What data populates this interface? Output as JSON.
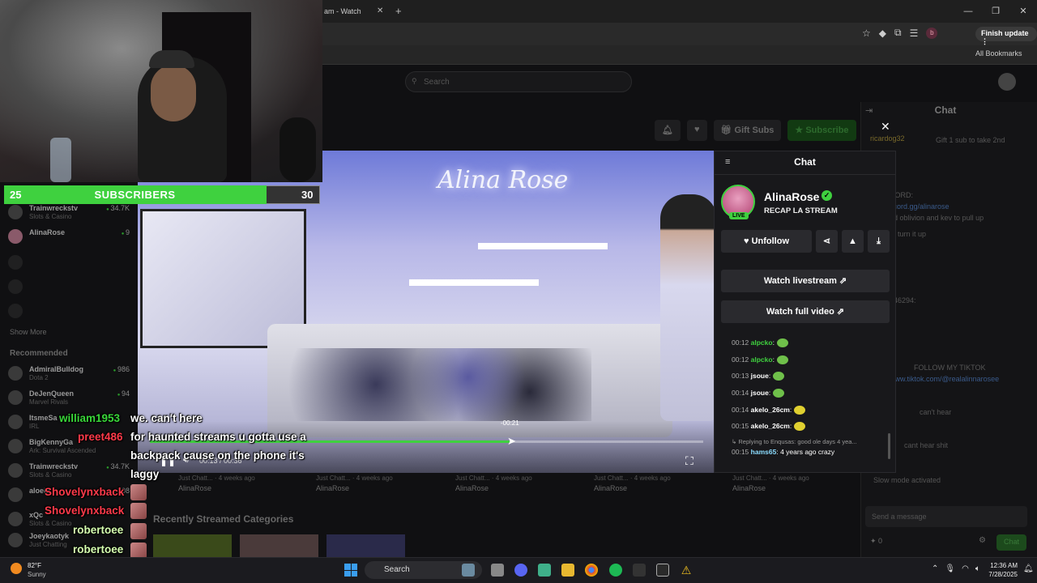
{
  "browser": {
    "tab_title": "am - Watch",
    "tab_close": "✕",
    "new_tab": "+",
    "window_controls": [
      "—",
      "❐",
      "✕"
    ],
    "finish_update": "Finish update ⋮",
    "all_bookmarks": "All Bookmarks",
    "profile_initial": "b"
  },
  "site": {
    "search_placeholder": "Search",
    "gift_subs": "Gift Subs",
    "subscribe": "Subscribe"
  },
  "sidebar": {
    "channels": [
      {
        "name": "Trainwreckstv",
        "sub": "Slots & Casino",
        "count": "34.7K"
      },
      {
        "name": "AlinaRose",
        "sub": "",
        "count": "9"
      }
    ],
    "show_more": "Show More",
    "recommended_label": "Recommended",
    "recommended": [
      {
        "name": "AdmiralBulldog",
        "sub": "Dota 2",
        "count": "986"
      },
      {
        "name": "DeJenQueen",
        "sub": "Marvel Rivals",
        "count": "94"
      },
      {
        "name": "ItsmeSa",
        "sub": "IRL",
        "count": ""
      },
      {
        "name": "BigKennyGa",
        "sub": "Ark: Survival Ascended",
        "count": ""
      },
      {
        "name": "Trainwreckstv",
        "sub": "Slots & Casino",
        "count": "34.7K"
      },
      {
        "name": "aloeid",
        "sub": "",
        "count": "308"
      },
      {
        "name": "xQc",
        "sub": "Slots & Casino",
        "count": ""
      },
      {
        "name": "Joeykaotyk",
        "sub": "Just Chatting",
        "count": ""
      }
    ]
  },
  "subgoal": {
    "current": "25",
    "label": "SUBSCRIBERS",
    "goal": "30",
    "progress": 0.83
  },
  "video": {
    "neon_sign": "Alina Rose",
    "hover_time": "-00:21",
    "elapsed": "00:13 / 00:36",
    "progress": 0.65
  },
  "under_video": {
    "items": [
      {
        "meta": "Just Chatt... · 4 weeks ago",
        "name": "AlinaRose"
      },
      {
        "meta": "Just Chatt... · 4 weeks ago",
        "name": "AlinaRose"
      },
      {
        "meta": "Just Chatt... · 4 weeks ago",
        "name": "AlinaRose"
      },
      {
        "meta": "Just Chatt... · 4 weeks ago",
        "name": "AlinaRose"
      },
      {
        "meta": "Just Chatt... · 4 weeks ago",
        "name": "AlinaRose"
      }
    ],
    "recent_categories": "Recently Streamed Categories"
  },
  "overlay_chat": [
    {
      "user": "william1953",
      "text": "we. can't here"
    },
    {
      "user": "preet486",
      "text": "for haunted streams u gotta use a"
    },
    {
      "user": "",
      "text": "backpack cause on the phone it's"
    },
    {
      "user": "",
      "text": "laggy"
    },
    {
      "user": "Shovelynxback",
      "text": ""
    },
    {
      "user": "Shovelynxback",
      "text": ""
    },
    {
      "user": "robertoee",
      "text": ""
    },
    {
      "user": "robertoee",
      "text": ""
    }
  ],
  "right_chat": {
    "title": "Chat",
    "gift_user": "ricardog32",
    "gift_text": "Gift 1 sub to take 2nd",
    "lines": [
      "CORD:",
      "scord.gg/alinarose",
      "nd oblivion and kev to pull up",
      "turn it up",
      "946294:",
      "FOLLOW MY TIKTOK",
      "www.tiktok.com/@realalinnarosee",
      "can't hear",
      "cant hear shit",
      "Slow mode activated"
    ],
    "input_placeholder": "Send a message",
    "points": "0",
    "chat_button": "Chat"
  },
  "popup": {
    "title": "Chat",
    "channel_name": "AlinaRose",
    "live_badge": "LIVE",
    "stream_title": "RECAP LA STREAM",
    "unfollow": "Unfollow",
    "watch_livestream": "Watch livestream",
    "watch_full_video": "Watch full video",
    "messages": [
      {
        "time": "00:12",
        "user": "alpcko",
        "text": "",
        "color": "#3fd13f",
        "emote": "green"
      },
      {
        "time": "00:12",
        "user": "alpcko",
        "text": "",
        "color": "#3fd13f",
        "emote": "green"
      },
      {
        "time": "00:13",
        "user": "jsoue",
        "text": "",
        "color": "#ffffff",
        "emote": "green"
      },
      {
        "time": "00:14",
        "user": "jsoue",
        "text": "",
        "color": "#ffffff",
        "emote": "green"
      },
      {
        "time": "00:14",
        "user": "akelo_26cm",
        "text": "",
        "color": "#ffffff",
        "emote": "yellow"
      },
      {
        "time": "00:15",
        "user": "akelo_26cm",
        "text": "",
        "color": "#ffffff",
        "emote": "yellow"
      }
    ],
    "reply_context": "Replying to Enqusas: good ole days 4 yea...",
    "last_msg": {
      "time": "00:15",
      "user": "hams65",
      "text": "4 years ago crazy"
    }
  },
  "taskbar": {
    "temp": "82°F",
    "condition": "Sunny",
    "search": "Search",
    "time": "12:36 AM",
    "date": "7/28/2025"
  },
  "colors": {
    "kick_green": "#3fd13f",
    "chat_red": "#ff3a4a"
  }
}
